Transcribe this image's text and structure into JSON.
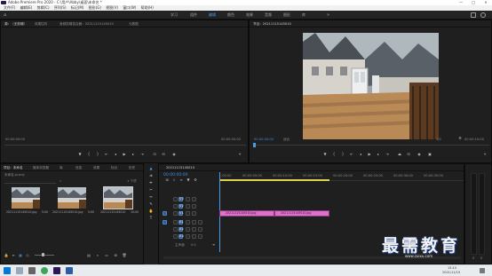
{
  "titlebar": {
    "title": "Adobe Premiere Pro 2020 - C:\\用户\\Abby\\桌面\\未命名 *",
    "minimize": "—",
    "maximize": "□",
    "close": "×"
  },
  "menus": [
    "文件(F)",
    "编辑(E)",
    "剪辑(C)",
    "序列(S)",
    "标记(M)",
    "图形(G)",
    "视图(V)",
    "窗口(W)",
    "帮助(H)"
  ],
  "workspaces": [
    "学习",
    "组件",
    "编辑",
    "颜色",
    "效果",
    "音频",
    "图形",
    "库"
  ],
  "active_workspace": "编辑",
  "source_panel": {
    "tabs": [
      "源：（无剪辑）",
      "效果控件",
      "音频剪辑混合器：20211115145010",
      "元数据"
    ],
    "timecode_left": "00:00:00:00",
    "timecode_right": "00:00:00:00"
  },
  "program_panel": {
    "tab": "节目：20211115145010",
    "timecode": "00:00:00:00",
    "fit": "适合",
    "resolution": "1/2",
    "duration": "00:00:10:00"
  },
  "project_panel": {
    "tabs": [
      "项目：未命名",
      "媒体浏览器",
      "库",
      "信息",
      "效果",
      "标记",
      "历史"
    ],
    "path": "未命名.prproj",
    "count": "1 个项",
    "clips": [
      {
        "name": "20211115145010.jpg",
        "dur": "5:00"
      },
      {
        "name": "20211115145010.jpg",
        "dur": "5:00"
      },
      {
        "name": "20211115145010",
        "dur": "10:00"
      }
    ]
  },
  "timeline": {
    "tab": "20211115145010",
    "timecode": "00:00:00:00",
    "ruler": [
      ":00:00",
      "00:00:05:00",
      "00:00:10:00",
      "00:00:15:00",
      "00:00:20:00",
      "00:00:25:00",
      "00:00:30:00",
      "00:00:35:00"
    ],
    "tracks": [
      "V3",
      "V2",
      "V1",
      "A1",
      "A2",
      "A3"
    ],
    "master": "主声道",
    "master_value": "0.0",
    "clips": [
      {
        "name": "20211115145010.jpg",
        "start": 0,
        "end": 5
      },
      {
        "name": "20211115145010.jpg",
        "start": 5,
        "end": 10
      }
    ]
  },
  "watermark": "最需教育",
  "watermark_sub": "www.zuixu.com",
  "taskbar": {
    "time": "15:10",
    "date": "2021/11/15"
  },
  "colors": {
    "accent": "#4c9be8",
    "clip": "#dd70c9",
    "titlebar": "#ffffff"
  }
}
